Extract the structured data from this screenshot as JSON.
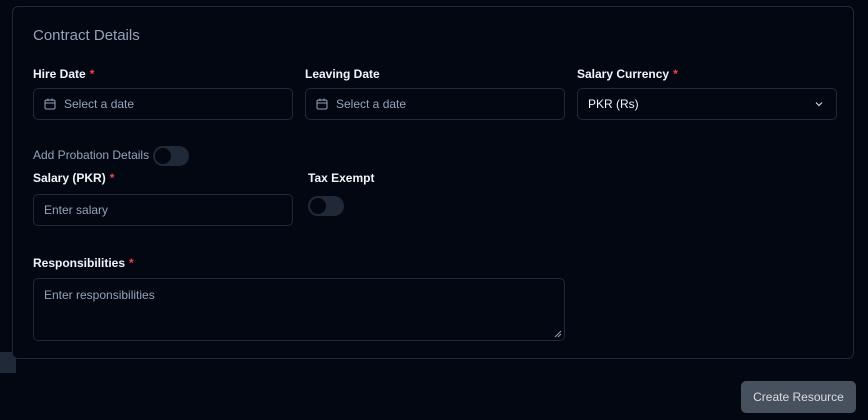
{
  "card": {
    "title": "Contract Details"
  },
  "hire_date": {
    "label": "Hire Date",
    "required_mark": "*",
    "placeholder": "Select a date"
  },
  "leaving_date": {
    "label": "Leaving Date",
    "placeholder": "Select a date"
  },
  "salary_currency": {
    "label": "Salary Currency",
    "required_mark": "*",
    "value": "PKR (Rs)"
  },
  "probation": {
    "label": "Add Probation Details",
    "enabled": false
  },
  "salary": {
    "label": "Salary (PKR)",
    "required_mark": "*",
    "placeholder": "Enter salary"
  },
  "tax_exempt": {
    "label": "Tax Exempt",
    "enabled": false
  },
  "responsibilities": {
    "label": "Responsibilities",
    "required_mark": "*",
    "placeholder": "Enter responsibilities"
  },
  "actions": {
    "create_label": "Create Resource"
  },
  "icons": {
    "date": "calendar-icon",
    "select": "chevron-down-icon",
    "resize": "resize-handle-icon"
  },
  "colors": {
    "background": "#030712",
    "border": "#1f2937",
    "required": "#ef4444",
    "button": "#4b5563"
  }
}
